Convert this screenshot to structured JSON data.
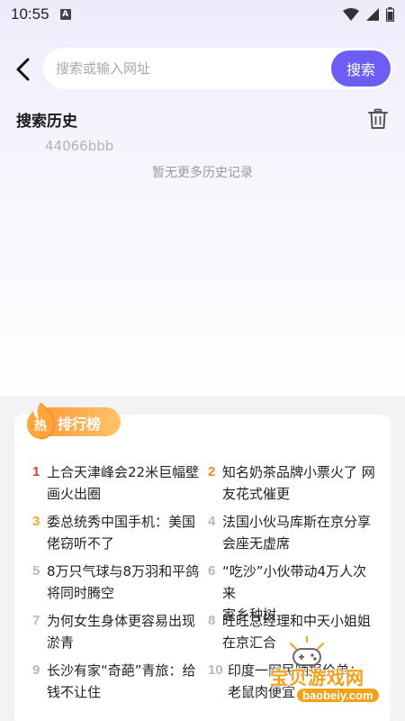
{
  "status_bar": {
    "time": "10:55",
    "notif_letter": "A"
  },
  "search": {
    "placeholder": "搜索或输入网址",
    "button_label": "搜索"
  },
  "history": {
    "title": "搜索历史",
    "items": [
      "44066bbb"
    ],
    "empty_text": "暂无更多历史记录"
  },
  "ranking": {
    "badge_label": "排行榜",
    "badge_icon_text": "热",
    "items": [
      {
        "rank": "1",
        "text_lines": [
          "上合天津峰会22米巨幅壁",
          "画火出圈"
        ]
      },
      {
        "rank": "2",
        "text_lines": [
          "知名奶茶品牌小票火了 网",
          "友花式催更"
        ]
      },
      {
        "rank": "3",
        "text_lines": [
          "委总统秀中国手机：美国",
          "佬窃听不了"
        ]
      },
      {
        "rank": "4",
        "text_lines": [
          "法国小伙马库斯在京分享",
          "会座无虚席"
        ]
      },
      {
        "rank": "5",
        "text_lines": [
          "8万只气球与8万羽和平鸽",
          "将同时腾空"
        ]
      },
      {
        "rank": "6",
        "text_lines": [
          "“吃沙”小伙带动4万人次来",
          "家乡种树"
        ]
      },
      {
        "rank": "7",
        "text_lines": [
          "为何女生身体更容易出现",
          "淤青"
        ]
      },
      {
        "rank": "8",
        "text_lines": [
          "旺旺总经理和中天小姐姐",
          "在京汇合"
        ]
      },
      {
        "rank": "9",
        "text_lines": [
          "长沙有家“奇葩”青旅：给",
          "钱不让住"
        ]
      },
      {
        "rank": "10",
        "text_lines": [
          "印度一网民晒报价单：",
          "老鼠肉便宜"
        ]
      }
    ]
  },
  "watermark": {
    "title": "宝贝游戏网",
    "url": "baobeiy.com"
  },
  "colors": {
    "accent": "#6c5ef2",
    "rank1": "#e23a34",
    "rank2": "#ef8a22",
    "rank3": "#f1a532",
    "badge": "#ff9a3c"
  }
}
